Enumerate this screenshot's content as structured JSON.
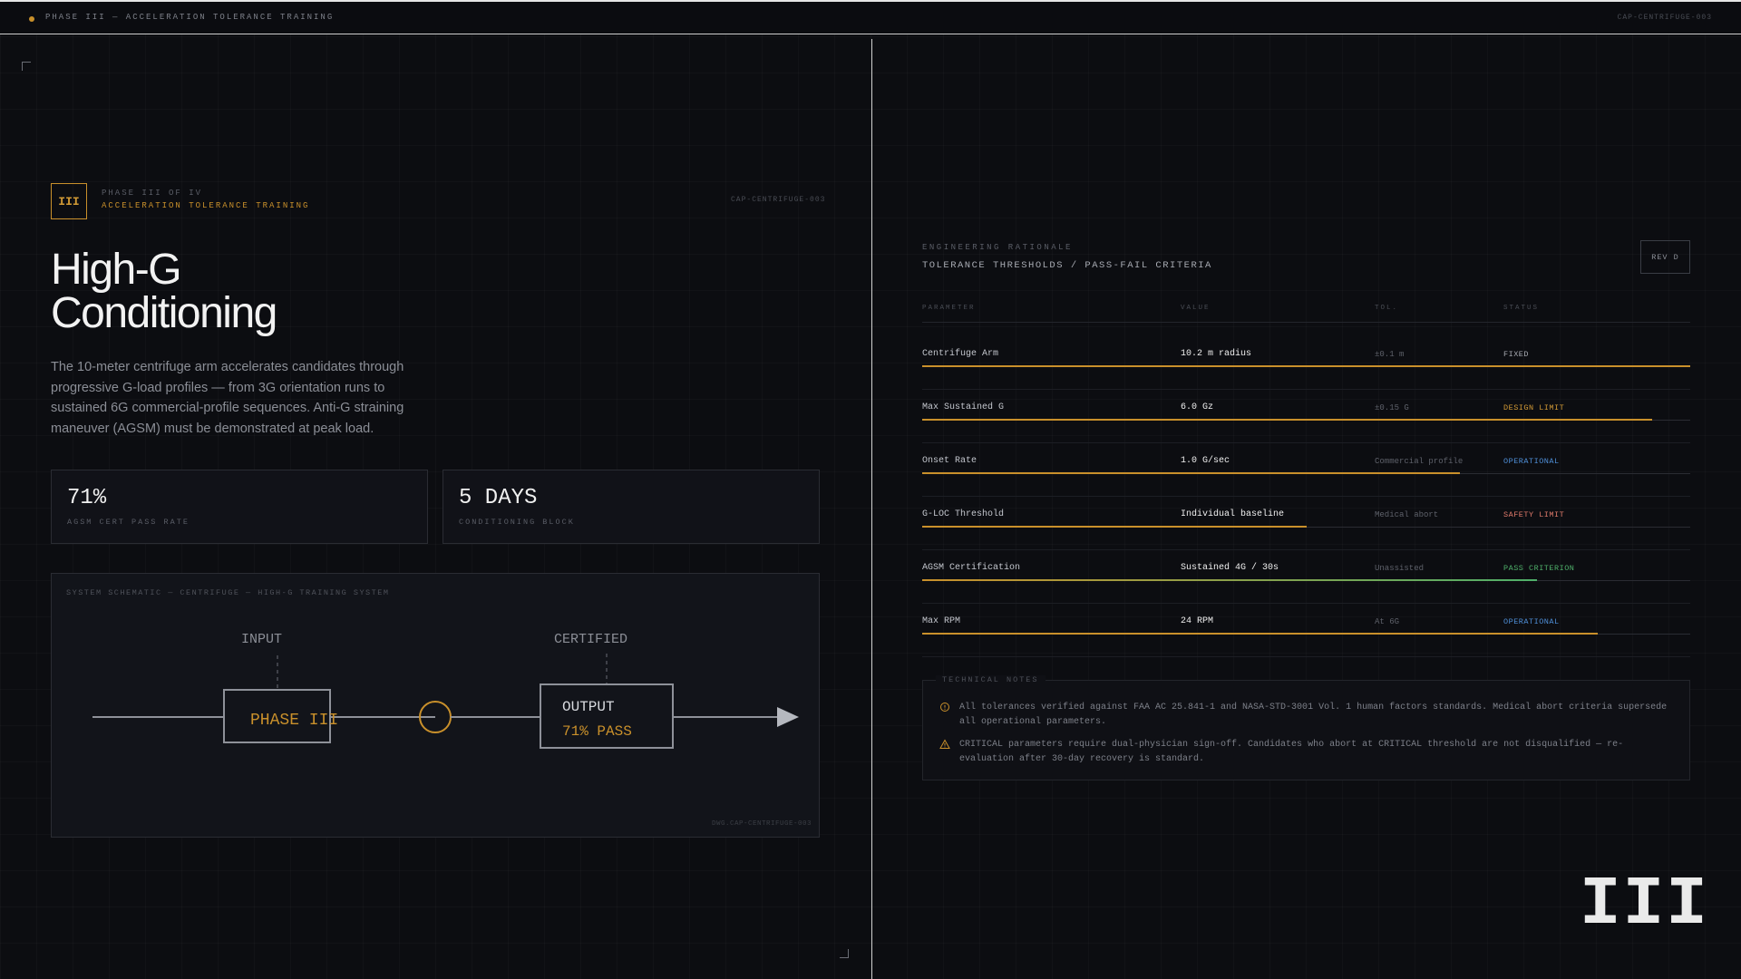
{
  "topbar": {
    "title": "PHASE III — ACCELERATION TOLERANCE TRAINING",
    "code": "CAP-CENTRIFUGE-003"
  },
  "left": {
    "badge": "III",
    "phase_of": "PHASE III OF IV",
    "phase_name": "ACCELERATION TOLERANCE TRAINING",
    "code": "CAP-CENTRIFUGE-003",
    "headline_line1": "High-G",
    "headline_line2": "Conditioning",
    "description": "The 10-meter centrifuge arm accelerates candidates through progressive G-load profiles — from 3G orientation runs to sustained 6G commercial-profile sequences. Anti-G straining maneuver (AGSM) must be demonstrated at peak load.",
    "stats": [
      {
        "value": "71%",
        "label": "AGSM CERT PASS RATE"
      },
      {
        "value": "5 DAYS",
        "label": "CONDITIONING BLOCK"
      }
    ],
    "schematic": {
      "caption": "SYSTEM SCHEMATIC — CENTRIFUGE — HIGH-G TRAINING SYSTEM",
      "input_label": "INPUT",
      "certified_label": "CERTIFIED",
      "phase_box": "PHASE III",
      "output_title": "OUTPUT",
      "output_value": "71% PASS",
      "drawing_code": "DWG.CAP-CENTRIFUGE-003"
    }
  },
  "right": {
    "eng_label": "ENGINEERING RATIONALE",
    "eng_sub": "TOLERANCE THRESHOLDS / PASS-FAIL CRITERIA",
    "rev": "REV D",
    "columns": [
      "PARAMETER",
      "VALUE",
      "TOL.",
      "STATUS"
    ],
    "rows": [
      {
        "param": "Centrifuge Arm",
        "value": "10.2 m radius",
        "tol": "±0.1 m",
        "status": "FIXED",
        "status_color": "#a8abb3",
        "fill": 1.0,
        "fill_color": "#c9902b"
      },
      {
        "param": "Max Sustained G",
        "value": "6.0 Gz",
        "tol": "±0.15 G",
        "status": "DESIGN LIMIT",
        "status_color": "#d39a35",
        "fill": 0.95,
        "fill_color": "#c9902b"
      },
      {
        "param": "Onset Rate",
        "value": "1.0 G/sec",
        "tol": "Commercial profile",
        "status": "OPERATIONAL",
        "status_color": "#4f8fd8",
        "fill": 0.7,
        "fill_color": "#c9902b"
      },
      {
        "param": "G-LOC Threshold",
        "value": "Individual baseline",
        "tol": "Medical abort",
        "status": "SAFETY LIMIT",
        "status_color": "#e07a6b",
        "fill": 0.5,
        "fill_color": "#c9902b"
      },
      {
        "param": "AGSM Certification",
        "value": "Sustained 4G / 30s",
        "tol": "Unassisted",
        "status": "PASS CRITERION",
        "status_color": "#4fb06a",
        "fill": 0.8,
        "fill_color": "linear-gradient(90deg,#c9902b,#4fb06a)"
      },
      {
        "param": "Max RPM",
        "value": "24 RPM",
        "tol": "At 6G",
        "status": "OPERATIONAL",
        "status_color": "#4f8fd8",
        "fill": 0.88,
        "fill_color": "#c9902b"
      }
    ],
    "notes_title": "TECHNICAL NOTES",
    "notes": [
      {
        "icon": "info-circle-icon",
        "text": "All tolerances verified against FAA AC 25.841-1 and NASA-STD-3001 Vol. 1 human factors standards. Medical abort criteria supersede all operational parameters."
      },
      {
        "icon": "warning-triangle-icon",
        "text": "CRITICAL parameters require dual-physician sign-off. Candidates who abort at CRITICAL threshold are not disqualified — re-evaluation after 30-day recovery is standard."
      }
    ],
    "big_roman": "III"
  }
}
